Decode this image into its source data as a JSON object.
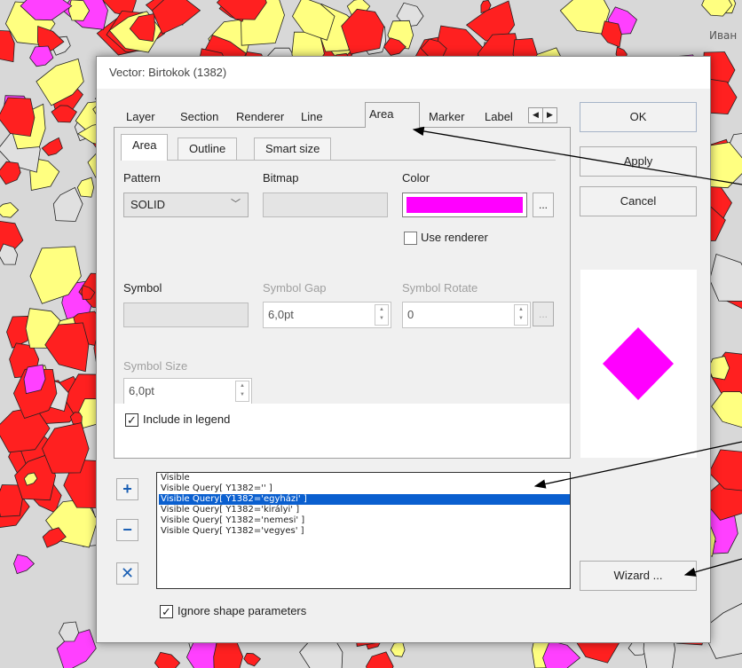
{
  "background": {
    "map_label": "Иван"
  },
  "dialog": {
    "title": "Vector: Birtokok (1382)",
    "tabs": [
      "Layer",
      "Section",
      "Renderer",
      "Line",
      "Area",
      "Marker",
      "Label"
    ],
    "active_tab": "Area",
    "subtabs": [
      "Area",
      "Outline",
      "Smart size"
    ],
    "active_subtab": "Area",
    "fields": {
      "pattern_label": "Pattern",
      "pattern_value": "SOLID",
      "bitmap_label": "Bitmap",
      "color_label": "Color",
      "color_value": "#ff00ff",
      "use_renderer_label": "Use renderer",
      "use_renderer_checked": false,
      "symbol_label": "Symbol",
      "symbol_gap_label": "Symbol Gap",
      "symbol_gap_value": "6,0pt",
      "symbol_rotate_label": "Symbol Rotate",
      "symbol_rotate_value": "0",
      "symbol_size_label": "Symbol Size",
      "symbol_size_value": "6,0pt",
      "ellipsis": "...",
      "include_legend_label": "Include in legend",
      "include_legend_checked": true
    },
    "buttons": {
      "ok": "OK",
      "apply": "Apply",
      "cancel": "Cancel",
      "wizard": "Wizard ..."
    },
    "preview": {
      "color": "#ff00ff"
    },
    "list_buttons": {
      "add": "+",
      "remove": "−",
      "clear": "✕"
    },
    "queries": [
      "Visible",
      "Visible Query[ Y1382='' ]",
      "Visible Query[ Y1382='egyházi' ]",
      "Visible Query[ Y1382='királyi' ]",
      "Visible Query[ Y1382='nemesi' ]",
      "Visible Query[ Y1382='vegyes' ]"
    ],
    "selected_query_index": 2,
    "ignore_shape_label": "Ignore shape parameters",
    "ignore_shape_checked": true
  }
}
